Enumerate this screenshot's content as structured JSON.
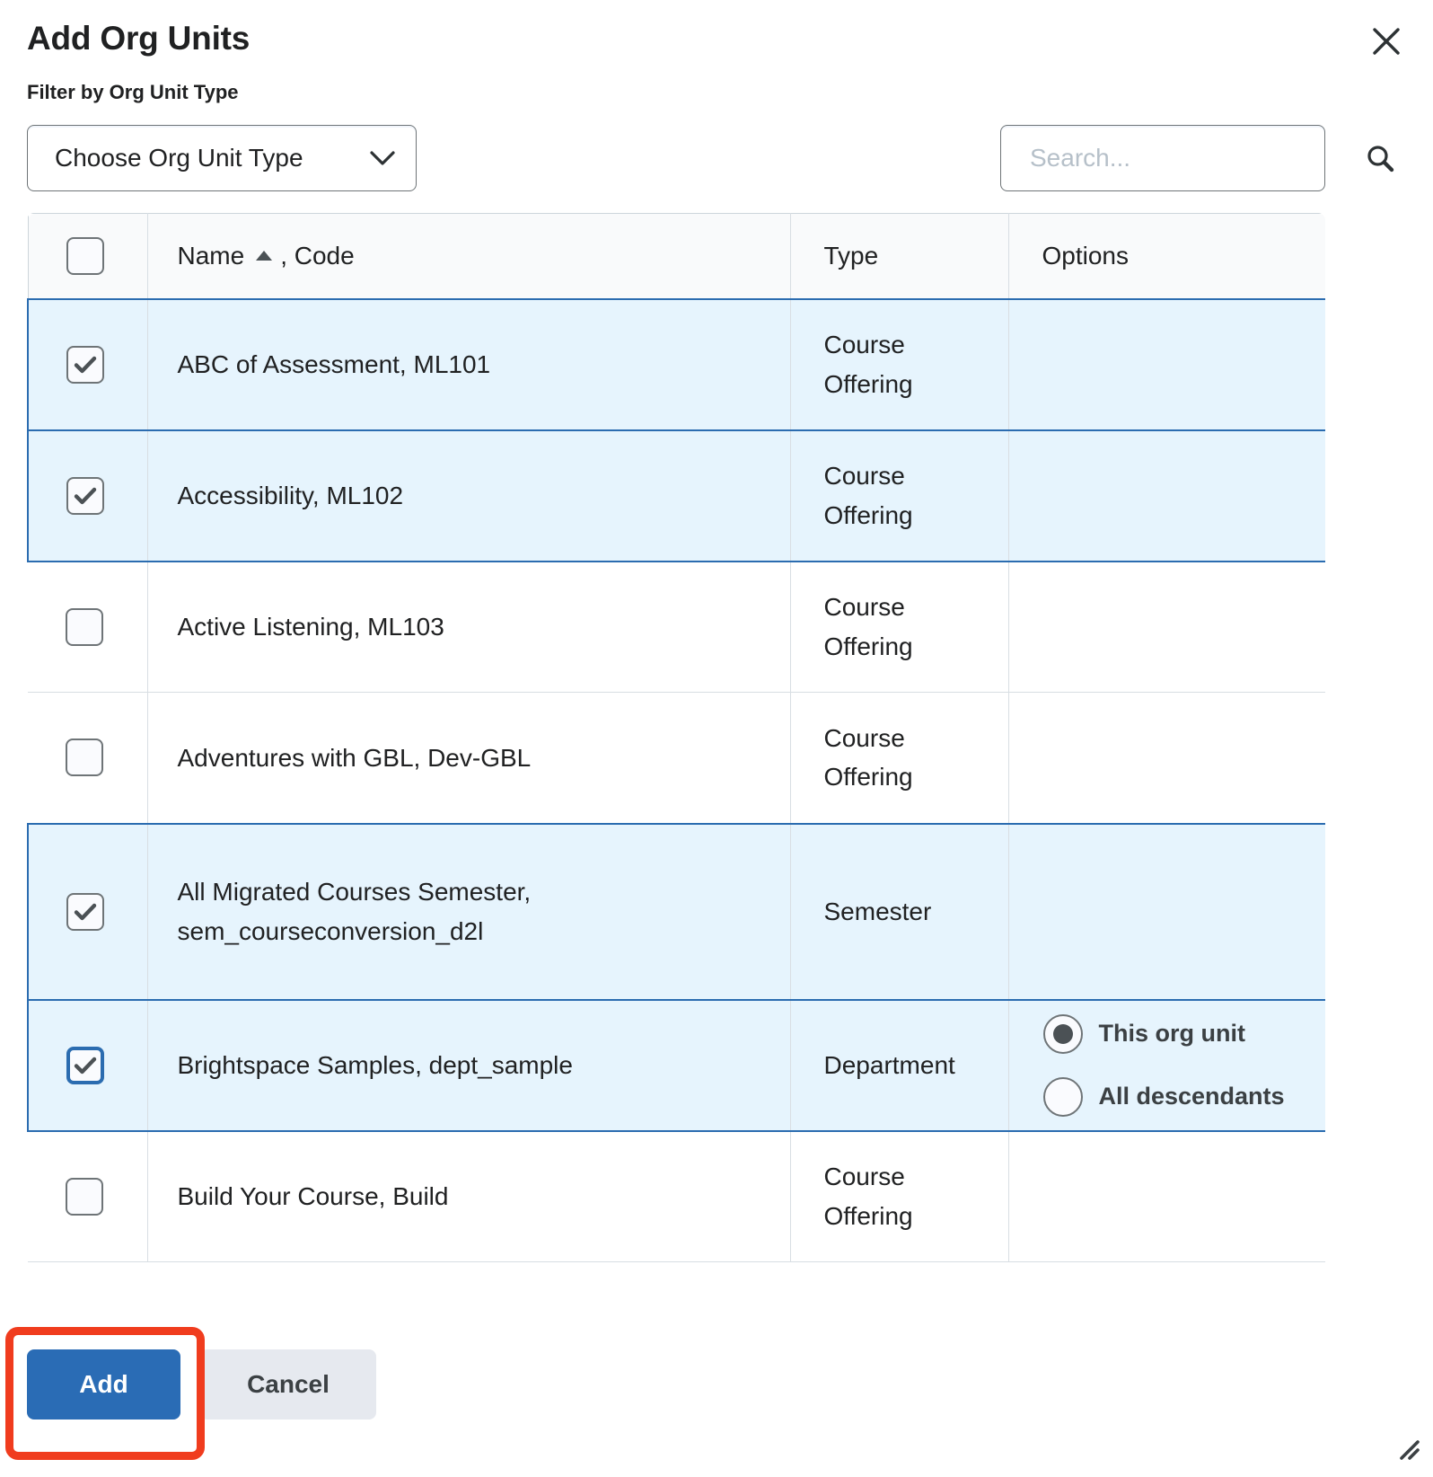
{
  "dialog": {
    "title": "Add Org Units",
    "close_icon": "close-icon"
  },
  "filter": {
    "label": "Filter by Org Unit Type",
    "select_value": "Choose Org Unit Type",
    "chevron_icon": "chevron-down-icon"
  },
  "search": {
    "value": "",
    "placeholder": "Search...",
    "icon": "search-icon"
  },
  "table": {
    "columns": [
      {
        "key": "check",
        "label": ""
      },
      {
        "key": "name",
        "label": "Name",
        "sort": "ascending",
        "suffix": ", Code"
      },
      {
        "key": "type",
        "label": "Type"
      },
      {
        "key": "options",
        "label": "Options"
      }
    ],
    "header_name_label": "Name",
    "header_name_suffix": ", Code",
    "header_type_label": "Type",
    "header_options_label": "Options",
    "select_all_checked": false,
    "rows": [
      {
        "name": "ABC of Assessment, ML101",
        "name_line2": "",
        "type": "Course Offering",
        "checked": true,
        "focused": false,
        "selected": true,
        "options": []
      },
      {
        "name": "Accessibility, ML102",
        "name_line2": "",
        "type": "Course Offering",
        "checked": true,
        "focused": false,
        "selected": true,
        "options": []
      },
      {
        "name": "Active Listening, ML103",
        "name_line2": "",
        "type": "Course Offering",
        "checked": false,
        "focused": false,
        "selected": false,
        "options": []
      },
      {
        "name": "Adventures with GBL, Dev-GBL",
        "name_line2": "",
        "type": "Course Offering",
        "checked": false,
        "focused": false,
        "selected": false,
        "options": []
      },
      {
        "name": "All Migrated Courses Semester,",
        "name_line2": "sem_courseconversion_d2l",
        "type": "Semester",
        "checked": true,
        "focused": false,
        "selected": true,
        "options": []
      },
      {
        "name": "Brightspace Samples, dept_sample",
        "name_line2": "",
        "type": "Department",
        "checked": true,
        "focused": true,
        "selected": true,
        "options": [
          {
            "label": "This org unit",
            "checked": true
          },
          {
            "label": "All descendants",
            "checked": false
          }
        ]
      },
      {
        "name": "Build Your Course, Build",
        "name_line2": "",
        "type": "Course Offering",
        "checked": false,
        "focused": false,
        "selected": false,
        "options": []
      }
    ]
  },
  "footer": {
    "add_label": "Add",
    "cancel_label": "Cancel"
  },
  "colors": {
    "primary": "#2a6cb5",
    "selected_row_bg": "#e6f4fd",
    "selected_row_border": "#2b6cb0",
    "highlight_annotation": "#f03c1e",
    "cancel_bg": "#e6e9ef"
  }
}
